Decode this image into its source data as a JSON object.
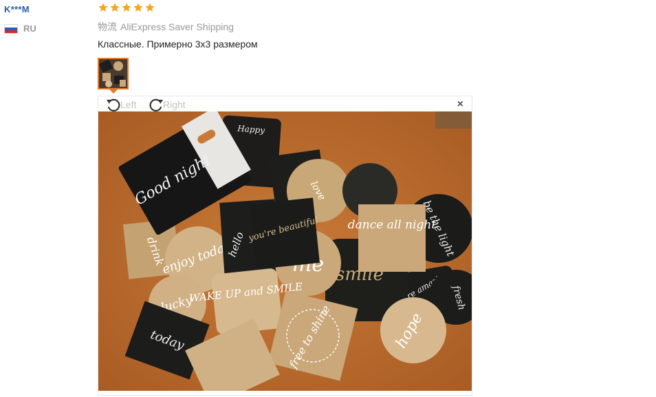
{
  "user": {
    "name": "K***M",
    "country_code": "RU",
    "flag_colors": [
      "#ffffff",
      "#1f5fbf",
      "#d52b1e"
    ]
  },
  "review": {
    "stars": 5,
    "star_color": "#f5a623",
    "shipping_label": "物流",
    "shipping_method": "AliExpress Saver Shipping",
    "comment": "Классные. Примерно 3х3 размером",
    "accent_color": "#e87a2a"
  },
  "viewer": {
    "rotate_left_label": "Left",
    "rotate_right_label": "Right",
    "close_symbol": "×"
  },
  "photo": {
    "sticker_texts": {
      "box": "Good night",
      "s_happy": "Happy",
      "s_enjoy": "enjoy today",
      "s_wake": "WAKE UP and SMILE",
      "s_dance": "dance all night",
      "s_beautiful": "you're beautiful",
      "s_hello": "hello",
      "s_me": "me",
      "s_smile": "smile",
      "s_light": "be the light",
      "s_lucky": "lucky",
      "s_drink": "drink",
      "s_free": "free to shine",
      "s_hope": "hope",
      "s_love": "love",
      "s_today": "today",
      "s_you": "you're amazing",
      "s_fresh": "fresh"
    }
  }
}
